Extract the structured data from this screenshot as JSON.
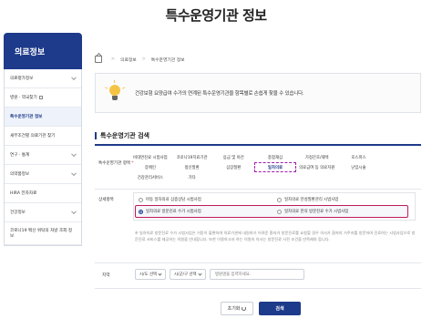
{
  "header": {
    "title": "특수운영기관 정보"
  },
  "sidebar": {
    "title": "의료정보",
    "items": [
      {
        "label": "의료평가정보",
        "active": false,
        "chevron": true
      },
      {
        "label": "병원 · 약국찾기",
        "active": false,
        "external": true
      },
      {
        "label": "특수운영기관 정보",
        "active": true
      },
      {
        "label": "새부조건별 의료기관 찾기",
        "active": false
      },
      {
        "label": "연구 · 통계",
        "active": false,
        "chevron": true
      },
      {
        "label": "의약품정보",
        "active": false,
        "chevron": true
      },
      {
        "label": "HIRA 전자자료",
        "active": false
      },
      {
        "label": "건강정보",
        "active": false,
        "chevron": true
      },
      {
        "label": "코로나19 백신 위탁의 처방 조회 정보",
        "active": false
      }
    ]
  },
  "breadcrumb": [
    "의료정보",
    "특수운영기관 정보"
  ],
  "info": {
    "text": "건강보험 요양급여 수가의 연계된 특수운영기관을 항목별로 손쉽게 찾을 수 있습니다."
  },
  "search": {
    "title": "특수운영기관 검색",
    "category_label": "특수운영기관 항목",
    "categories": [
      "비대면진료 시범사업",
      "코로나19치료기관",
      "응급 및 야간",
      "종합재심",
      "가정간호/재택",
      "호스피스",
      "장애인",
      "정신질환",
      "심장질환",
      "일차의료",
      "의료급여 등 의료지원",
      "난임시술",
      "건강관리서비스",
      "기타"
    ],
    "selected_category": "일차의료",
    "detail_label": "상세항목",
    "detail_options": [
      {
        "label": "아동 일차의료 심층상담 시범사업",
        "selected": false
      },
      {
        "label": "일차의료 만성질환관리 시범사업",
        "selected": false
      },
      {
        "label": "일차의료 방문진료 수가 시범사업",
        "selected": true
      },
      {
        "label": "일차의료 한의 방문진료 수가 시범사업",
        "selected": false
      }
    ],
    "note": "※ 일차의료 방문진료 수가 시범사업은 거동이 불편하여 의료기관에 내원하기 어려운 환자가 방문진료를 요청할 경우 의사가 환자의 거주지를 방문하여 진료하는 시범사업으로 방문진료 서비스를 제공하는 의원을 안내합니다. 또한 이용하고자 하는 의원의 의사는 방문진료 사전 조건을 만족해야 합니다.",
    "region_label": "지역",
    "sido": "시/도 선택",
    "sigungu": "시/군/구 선택",
    "name_placeholder": "병원명을 입력하세요.",
    "reset_label": "초기화",
    "search_label": "검색"
  },
  "colors": {
    "primary": "#1e3a8a",
    "highlight": "#c2185b",
    "selected_dash": "#a21caf"
  }
}
